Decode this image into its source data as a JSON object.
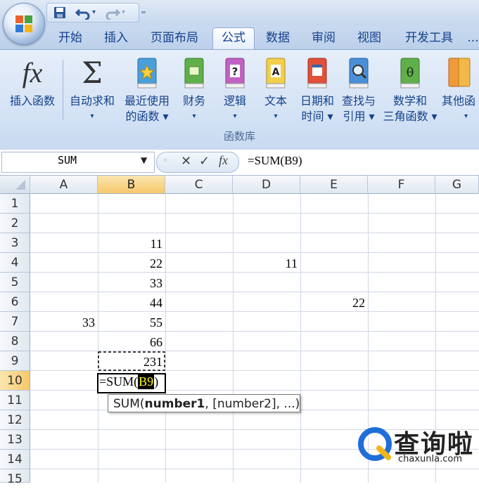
{
  "quick_access": {
    "save": "save-icon",
    "undo": "undo-icon",
    "redo": "redo-icon",
    "customize": "customize-qat-icon"
  },
  "tabs": [
    "开始",
    "插入",
    "页面布局",
    "公式",
    "数据",
    "审阅",
    "视图",
    "开发工具"
  ],
  "active_tab": "公式",
  "ribbon": {
    "buttons": [
      {
        "line1": "插入函数",
        "line2": "",
        "icon": "fx-icon"
      },
      {
        "line1": "自动求和",
        "line2": "▾",
        "icon": "sigma-icon"
      },
      {
        "line1": "最近使用",
        "line2": "的函数 ▾",
        "icon": "star-book-icon"
      },
      {
        "line1": "财务",
        "line2": "▾",
        "icon": "finance-book-icon"
      },
      {
        "line1": "逻辑",
        "line2": "▾",
        "icon": "logic-book-icon"
      },
      {
        "line1": "文本",
        "line2": "▾",
        "icon": "text-book-icon"
      },
      {
        "line1": "日期和",
        "line2": "时间 ▾",
        "icon": "date-book-icon"
      },
      {
        "line1": "查找与",
        "line2": "引用 ▾",
        "icon": "lookup-book-icon"
      },
      {
        "line1": "数学和",
        "line2": "三角函数 ▾",
        "icon": "math-book-icon"
      },
      {
        "line1": "其他函",
        "line2": "▾",
        "icon": "more-books-icon"
      }
    ],
    "group_label": "函数库"
  },
  "formula_bar": {
    "name_box": "SUM",
    "formula": "=SUM(B9)"
  },
  "columns": [
    "A",
    "B",
    "C",
    "D",
    "E",
    "F",
    "G"
  ],
  "selected_column": "B",
  "rows": [
    "1",
    "2",
    "3",
    "4",
    "5",
    "6",
    "7",
    "8",
    "9",
    "10",
    "11",
    "12",
    "13",
    "14",
    "15"
  ],
  "selected_row": "10",
  "cells": [
    {
      "ref": "B3",
      "value": "11"
    },
    {
      "ref": "B4",
      "value": "22"
    },
    {
      "ref": "D4",
      "value": "11"
    },
    {
      "ref": "B5",
      "value": "33"
    },
    {
      "ref": "B6",
      "value": "44"
    },
    {
      "ref": "E6",
      "value": "22"
    },
    {
      "ref": "A7",
      "value": "33"
    },
    {
      "ref": "B7",
      "value": "55"
    },
    {
      "ref": "B8",
      "value": "66"
    },
    {
      "ref": "B9",
      "value": "231"
    }
  ],
  "editing": {
    "prefix": "=SUM(",
    "ref": "B9",
    "suffix": ")"
  },
  "tooltip": {
    "fn": "SUM(",
    "arg1": "number1",
    "rest": ", [number2], ...)"
  },
  "watermark": {
    "name": "查询啦",
    "url": "chaxunla.com"
  }
}
